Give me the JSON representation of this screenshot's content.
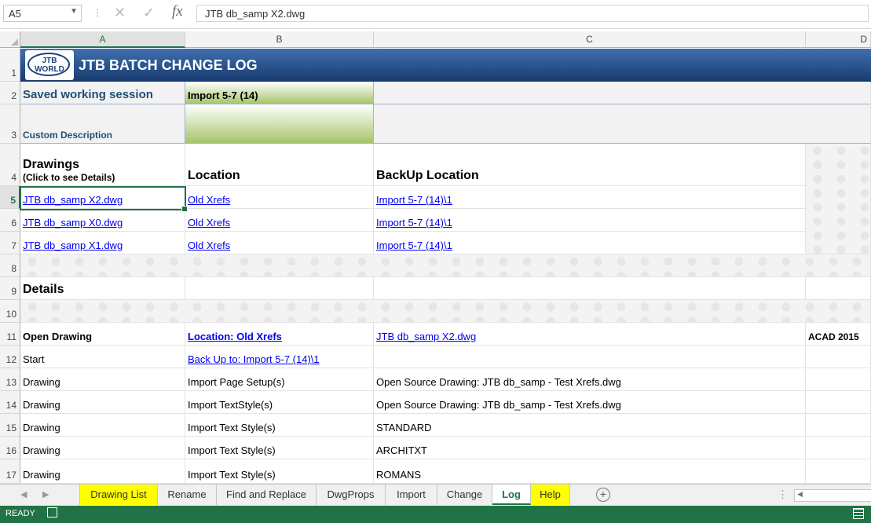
{
  "formula_bar": {
    "name_box": "A5",
    "formula": "JTB db_samp X2.dwg",
    "fx_label": "fx"
  },
  "columns": [
    "A",
    "B",
    "C",
    "D"
  ],
  "rows": [
    "1",
    "2",
    "3",
    "4",
    "5",
    "6",
    "7",
    "8",
    "9",
    "10",
    "11",
    "12",
    "13",
    "14",
    "15",
    "16",
    "17"
  ],
  "logo": {
    "line1": "JTB",
    "line2": "WORLD"
  },
  "title": "JTB BATCH CHANGE LOG",
  "saved_session": {
    "label": "Saved working session",
    "value": "Import 5-7 (14)"
  },
  "custom_description": {
    "label": "Custom Description"
  },
  "drawings_header": {
    "title": "Drawings",
    "subtitle": "(Click to see Details)",
    "location": "Location",
    "backup": "BackUp Location"
  },
  "drawings": [
    {
      "name": "JTB db_samp X2.dwg",
      "location": "Old Xrefs",
      "backup": "Import 5-7 (14)\\1"
    },
    {
      "name": "JTB db_samp X0.dwg",
      "location": "Old Xrefs",
      "backup": "Import 5-7 (14)\\1"
    },
    {
      "name": "JTB db_samp X1.dwg",
      "location": "Old Xrefs",
      "backup": "Import 5-7 (14)\\1"
    }
  ],
  "details_header": "Details",
  "details": [
    {
      "a": "Open Drawing",
      "b": "Location: Old Xrefs",
      "c": "JTB db_samp X2.dwg",
      "d": "ACAD 2015"
    },
    {
      "a": "Start",
      "b": "Back Up to: Import 5-7 (14)\\1",
      "c": "",
      "d": ""
    },
    {
      "a": "Drawing",
      "b": "Import Page Setup(s)",
      "c": "Open Source Drawing: JTB db_samp - Test Xrefs.dwg",
      "d": ""
    },
    {
      "a": "Drawing",
      "b": "Import TextStyle(s)",
      "c": "Open Source Drawing: JTB db_samp - Test Xrefs.dwg",
      "d": ""
    },
    {
      "a": "Drawing",
      "b": "Import Text Style(s)",
      "c": "STANDARD",
      "d": ""
    },
    {
      "a": "Drawing",
      "b": "Import Text Style(s)",
      "c": "ARCHITXT",
      "d": ""
    },
    {
      "a": "Drawing",
      "b": "Import Text Style(s)",
      "c": "ROMANS",
      "d": ""
    }
  ],
  "sheet_tabs": [
    "Drawing List",
    "Rename",
    "Find and Replace",
    "DwgProps",
    "Import",
    "Change",
    "Log",
    "Help"
  ],
  "status": {
    "ready": "READY"
  }
}
